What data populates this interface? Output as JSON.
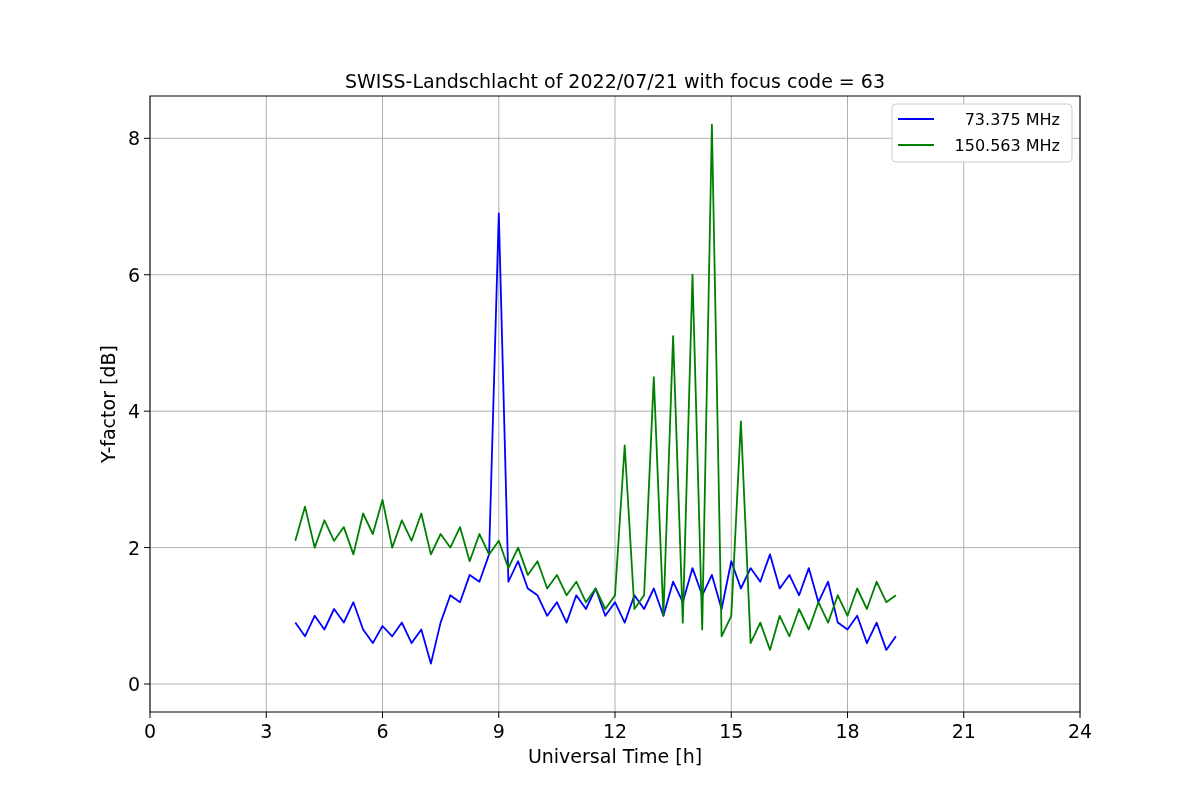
{
  "chart_data": {
    "type": "line",
    "title": "SWISS-Landschlacht of 2022/07/21 with focus code = 63",
    "xlabel": "Universal Time [h]",
    "ylabel": "Y-factor [dB]",
    "x": [
      3.75,
      4.0,
      4.25,
      4.5,
      4.75,
      5.0,
      5.25,
      5.5,
      5.75,
      6.0,
      6.25,
      6.5,
      6.75,
      7.0,
      7.25,
      7.5,
      7.75,
      8.0,
      8.25,
      8.5,
      8.75,
      9.0,
      9.25,
      9.5,
      9.75,
      10.0,
      10.25,
      10.5,
      10.75,
      11.0,
      11.25,
      11.5,
      11.75,
      12.0,
      12.25,
      12.5,
      12.75,
      13.0,
      13.25,
      13.5,
      13.75,
      14.0,
      14.25,
      14.5,
      14.75,
      15.0,
      15.25,
      15.5,
      15.75,
      16.0,
      16.25,
      16.5,
      16.75,
      17.0,
      17.25,
      17.5,
      17.75,
      18.0,
      18.25,
      18.5,
      18.75,
      19.0,
      19.25
    ],
    "series": [
      {
        "name": "73.375 MHz",
        "color": "#0000ff",
        "values": [
          0.9,
          0.7,
          1.0,
          0.8,
          1.1,
          0.9,
          1.2,
          0.8,
          0.6,
          0.85,
          0.7,
          0.9,
          0.6,
          0.8,
          0.3,
          0.9,
          1.3,
          1.2,
          1.6,
          1.5,
          1.9,
          6.9,
          1.5,
          1.8,
          1.4,
          1.3,
          1.0,
          1.2,
          0.9,
          1.3,
          1.1,
          1.4,
          1.0,
          1.2,
          0.9,
          1.3,
          1.1,
          1.4,
          1.0,
          1.5,
          1.2,
          1.7,
          1.3,
          1.6,
          1.1,
          1.8,
          1.4,
          1.7,
          1.5,
          1.9,
          1.4,
          1.6,
          1.3,
          1.7,
          1.2,
          1.5,
          0.9,
          0.8,
          1.0,
          0.6,
          0.9,
          0.5,
          0.7
        ]
      },
      {
        "name": "150.563 MHz",
        "color": "#008000",
        "values": [
          2.1,
          2.6,
          2.0,
          2.4,
          2.1,
          2.3,
          1.9,
          2.5,
          2.2,
          2.7,
          2.0,
          2.4,
          2.1,
          2.5,
          1.9,
          2.2,
          2.0,
          2.3,
          1.8,
          2.2,
          1.9,
          2.1,
          1.7,
          2.0,
          1.6,
          1.8,
          1.4,
          1.6,
          1.3,
          1.5,
          1.2,
          1.4,
          1.1,
          1.3,
          3.5,
          1.1,
          1.3,
          4.5,
          1.0,
          5.1,
          0.9,
          6.0,
          0.8,
          8.2,
          0.7,
          1.0,
          3.85,
          0.6,
          0.9,
          0.5,
          1.0,
          0.7,
          1.1,
          0.8,
          1.2,
          0.9,
          1.3,
          1.0,
          1.4,
          1.1,
          1.5,
          1.2,
          1.3
        ]
      }
    ],
    "grid": true,
    "legend": "upper right",
    "xlim": [
      0,
      24
    ],
    "ylim": [
      -0.41,
      8.62
    ],
    "xticks": [
      0,
      3,
      6,
      9,
      12,
      15,
      18,
      21,
      24
    ],
    "yticks": [
      0,
      2,
      4,
      6,
      8
    ]
  }
}
